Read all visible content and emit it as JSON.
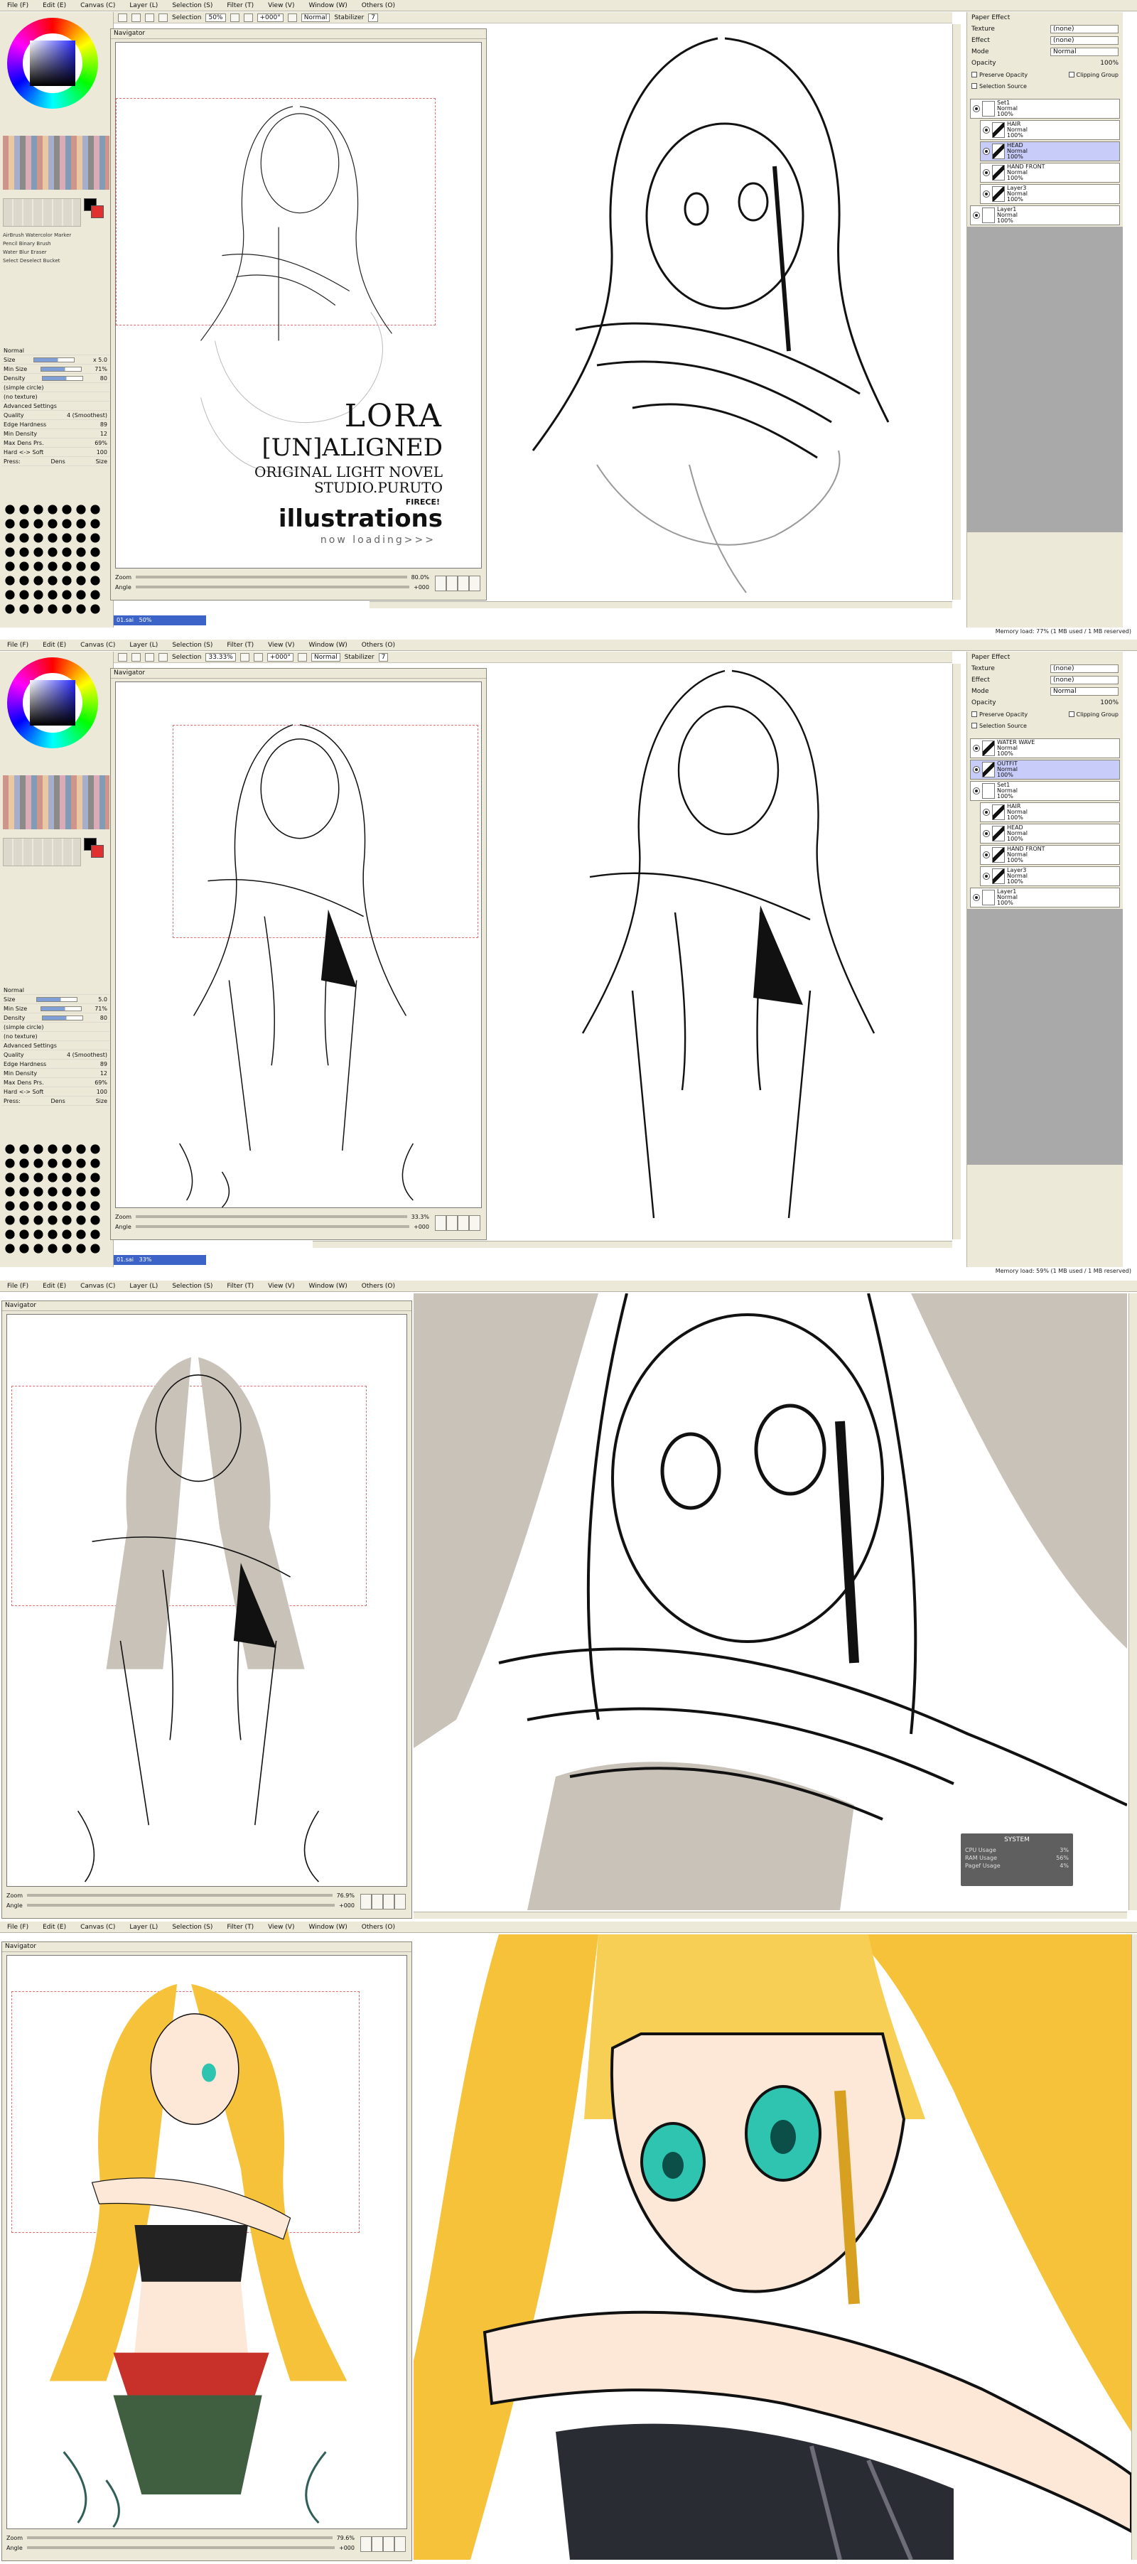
{
  "menu": [
    "File (F)",
    "Edit (E)",
    "Canvas (C)",
    "Layer (L)",
    "Selection (S)",
    "Filter (T)",
    "View (V)",
    "Window (W)",
    "Others (O)"
  ],
  "toolbar": {
    "selection_label": "Selection",
    "zoom_1": "50%",
    "zoom_2": "33.33%",
    "angle": "+000°",
    "blend": "Normal",
    "stabilizer_label": "Stabilizer",
    "stabilizer_value": "7"
  },
  "navigator": {
    "title": "Navigator",
    "zoom_label": "Zoom",
    "angle_label": "Angle",
    "zoom_1": "80.0%",
    "zoom_2": "33.3%",
    "zoom_3": "76.9%",
    "zoom_4": "79.6%",
    "angle_value": "+000"
  },
  "tools": {
    "brush_types": [
      "AirBrush",
      "Watercolor",
      "Marker",
      "Pencil",
      "Binary",
      "Brush",
      "Water",
      "Blur",
      "Eraser",
      "Select",
      "Deselect",
      "Bucket"
    ],
    "size_label": "Size",
    "size_value": "x 5.0",
    "size_px": "5.0",
    "min_size_label": "Min Size",
    "min_size_value": "71%",
    "density_label": "Density",
    "density_value": "80",
    "simple_circle": "(simple circle)",
    "no_texture": "(no texture)",
    "advanced": "Advanced Settings",
    "quality_label": "Quality",
    "quality_value": "4 (Smoothest)",
    "edge_label": "Edge Hardness",
    "edge_value": "89",
    "min_density_label": "Min Density",
    "min_density_value": "12",
    "max_dens_label": "Max Dens Prs.",
    "max_dens_value": "69%",
    "hard_soft_label": "Hard <-> Soft",
    "hard_soft_value": "100",
    "press_label": "Press:",
    "press_dens": "Dens",
    "press_size": "Size",
    "mode_label": "Normal",
    "brush_sizes": [
      "0.7",
      "0.8",
      "1",
      "1.5",
      "2",
      "2.3",
      "2.6",
      "3",
      "3.5",
      "4"
    ]
  },
  "status_strip": {
    "file_1": "01.sai",
    "zoom_1": "50%",
    "zoom_2": "33%"
  },
  "layers_panel": {
    "paper_effect": "Paper Effect",
    "texture_label": "Texture",
    "texture_value": "(none)",
    "effect_label": "Effect",
    "effect_value": "(none)",
    "mode_label": "Mode",
    "mode_value": "Normal",
    "opacity_label": "Opacity",
    "opacity_value": "100%",
    "preserve_opacity": "Preserve Opacity",
    "clipping_group": "Clipping Group",
    "selection_source": "Selection Source",
    "layers_1": [
      {
        "name": "Set1",
        "mode": "Normal",
        "opacity": "100%",
        "indent": false,
        "sel": false,
        "dark": false
      },
      {
        "name": "HAIR",
        "mode": "Normal",
        "opacity": "100%",
        "indent": true,
        "sel": false,
        "dark": true
      },
      {
        "name": "HEAD",
        "mode": "Normal",
        "opacity": "100%",
        "indent": true,
        "sel": true,
        "dark": true
      },
      {
        "name": "HAND FRONT",
        "mode": "Normal",
        "opacity": "100%",
        "indent": true,
        "sel": false,
        "dark": true
      },
      {
        "name": "Layer3",
        "mode": "Normal",
        "opacity": "100%",
        "indent": true,
        "sel": false,
        "dark": true
      },
      {
        "name": "Layer1",
        "mode": "Normal",
        "opacity": "100%",
        "indent": false,
        "sel": false,
        "dark": false
      }
    ],
    "layers_2": [
      {
        "name": "WATER WAVE",
        "mode": "Normal",
        "opacity": "100%",
        "indent": false,
        "sel": false,
        "dark": true
      },
      {
        "name": "OUTFIT",
        "mode": "Normal",
        "opacity": "100%",
        "indent": false,
        "sel": true,
        "dark": true
      },
      {
        "name": "Set1",
        "mode": "Normal",
        "opacity": "100%",
        "indent": false,
        "sel": false,
        "dark": false
      },
      {
        "name": "HAIR",
        "mode": "Normal",
        "opacity": "100%",
        "indent": true,
        "sel": false,
        "dark": true
      },
      {
        "name": "HEAD",
        "mode": "Normal",
        "opacity": "100%",
        "indent": true,
        "sel": false,
        "dark": true
      },
      {
        "name": "HAND FRONT",
        "mode": "Normal",
        "opacity": "100%",
        "indent": true,
        "sel": false,
        "dark": true
      },
      {
        "name": "Layer3",
        "mode": "Normal",
        "opacity": "100%",
        "indent": true,
        "sel": false,
        "dark": true
      },
      {
        "name": "Layer1",
        "mode": "Normal",
        "opacity": "100%",
        "indent": false,
        "sel": false,
        "dark": false
      }
    ]
  },
  "memory": {
    "line_1": "Memory load: 77% (1 MB used / 1 MB reserved)",
    "line_2": "Memory load: 59% (1 MB used / 1 MB reserved)"
  },
  "watermark": {
    "title": "LORA",
    "subtitle": "[UN]ALIGNED",
    "line_1": "ORIGINAL LIGHT NOVEL",
    "line_2": "STUDIO.PURUTO",
    "brand": "illustrations",
    "tag": "FIRECE!",
    "loading": "now loading>>>"
  },
  "system_widget": {
    "title": "SYSTEM",
    "rows": [
      {
        "label": "CPU Usage",
        "value": "3%"
      },
      {
        "label": "RAM Usage",
        "value": "56%"
      },
      {
        "label": "Pagef Usage",
        "value": "4%"
      }
    ]
  },
  "colors": {
    "accent_selected": "#c8ccf8",
    "title_strip": "#3c64c8",
    "hair_yellow": "#f5c23a",
    "eye_teal": "#2ec4b0",
    "shade_grey": "#c9c2b8"
  }
}
